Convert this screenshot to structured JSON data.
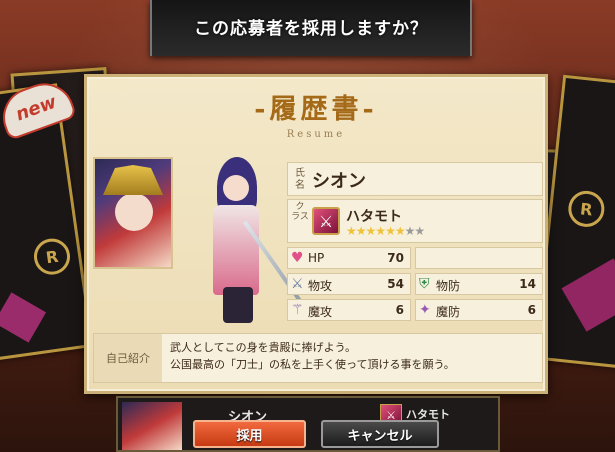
{
  "header": {
    "question": "この応募者を採用しますか？"
  },
  "background": {
    "new_badge": "new",
    "card_emblem": "R"
  },
  "resume": {
    "title": "-履歴書-",
    "subtitle": "Resume",
    "name_label": "氏名",
    "name": "シオン",
    "class_label": "クラス",
    "class_name": "ハタモト",
    "class_icon": "sword-icon",
    "stars": {
      "filled": 6,
      "total": 8
    },
    "stats": {
      "hp_label": "HP",
      "hp": "70",
      "atk_label": "物攻",
      "atk": "54",
      "def_label": "物防",
      "def": "14",
      "matk_label": "魔攻",
      "matk": "6",
      "mdef_label": "魔防",
      "mdef": "6"
    },
    "intro_label": "自己紹介",
    "intro_line1": "武人としてこの身を貴殿に捧げよう。",
    "intro_line2": "公国最高の「刀士」の私を上手く使って頂ける事を願う。"
  },
  "bottom": {
    "name": "シオン",
    "class_name": "ハタモト"
  },
  "buttons": {
    "hire": "採用",
    "cancel": "キャンセル"
  },
  "colors": {
    "title_gold": "#a56a18",
    "hire_button": "#e0552a",
    "star_on": "#f0c23a",
    "star_off": "#9a9a9a"
  }
}
